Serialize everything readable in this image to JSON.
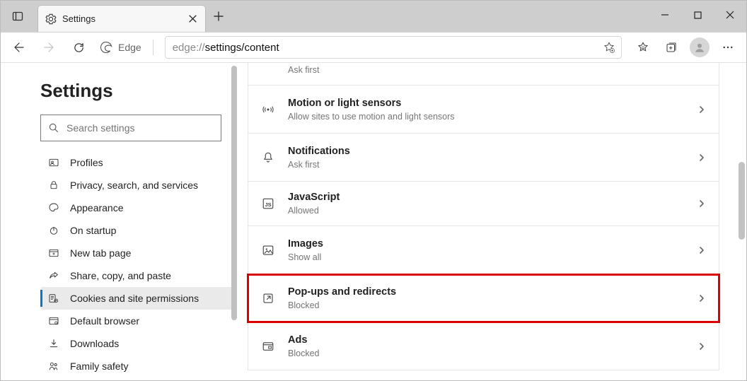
{
  "window": {
    "tab_title": "Settings",
    "brand_label": "Edge"
  },
  "addressbar": {
    "url_gray": "edge://",
    "url_black": "settings/content"
  },
  "sidebar": {
    "heading": "Settings",
    "search_placeholder": "Search settings",
    "items": [
      {
        "label": "Profiles"
      },
      {
        "label": "Privacy, search, and services"
      },
      {
        "label": "Appearance"
      },
      {
        "label": "On startup"
      },
      {
        "label": "New tab page"
      },
      {
        "label": "Share, copy, and paste"
      },
      {
        "label": "Cookies and site permissions"
      },
      {
        "label": "Default browser"
      },
      {
        "label": "Downloads"
      },
      {
        "label": "Family safety"
      }
    ]
  },
  "settings": [
    {
      "title": "",
      "sub": "Ask first"
    },
    {
      "title": "Motion or light sensors",
      "sub": "Allow sites to use motion and light sensors"
    },
    {
      "title": "Notifications",
      "sub": "Ask first"
    },
    {
      "title": "JavaScript",
      "sub": "Allowed"
    },
    {
      "title": "Images",
      "sub": "Show all"
    },
    {
      "title": "Pop-ups and redirects",
      "sub": "Blocked"
    },
    {
      "title": "Ads",
      "sub": "Blocked"
    }
  ]
}
